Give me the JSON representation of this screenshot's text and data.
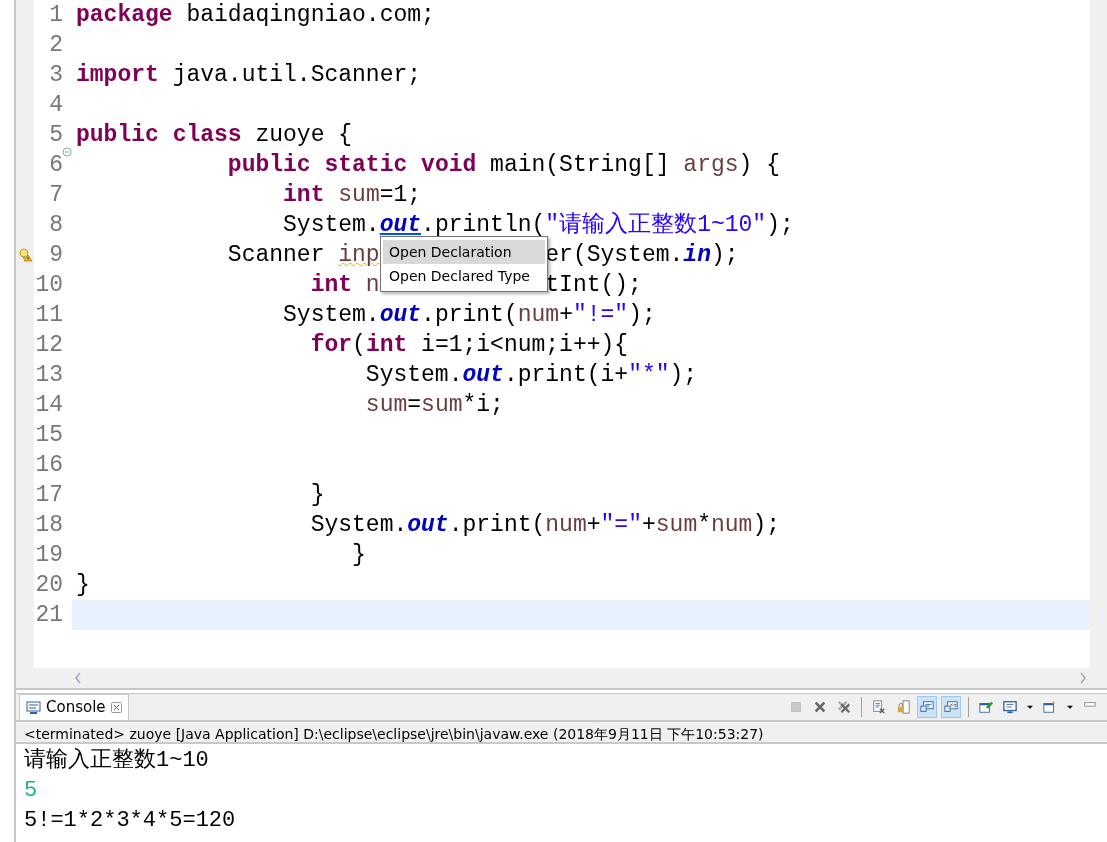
{
  "editor": {
    "lines": [
      {
        "number": "1",
        "kind": "plain",
        "current": false,
        "tokens": [
          {
            "kind": "keyword",
            "text": "package"
          },
          {
            "kind": "plain",
            "text": " baidaqingniao.com;"
          }
        ]
      },
      {
        "number": "2",
        "kind": "plain",
        "current": false
      },
      {
        "number": "3",
        "kind": "plain",
        "current": false,
        "tokens": [
          {
            "kind": "keyword",
            "text": "import"
          },
          {
            "kind": "plain",
            "text": " java.util.Scanner;"
          }
        ]
      },
      {
        "number": "4",
        "kind": "plain",
        "current": false
      },
      {
        "number": "5",
        "kind": "plain",
        "current": false,
        "tokens": [
          {
            "kind": "keyword",
            "text": "public"
          },
          {
            "kind": "keyword",
            "text": " class"
          },
          {
            "kind": "plain",
            "text": " zuoye {"
          }
        ]
      },
      {
        "number": "6",
        "kind": "fold",
        "current": false,
        "tokens": [
          {
            "kind": "keyword",
            "text": "           public"
          },
          {
            "kind": "keyword",
            "text": " static"
          },
          {
            "kind": "keyword",
            "text": " void"
          },
          {
            "kind": "plain",
            "text": " main(String[] "
          },
          {
            "kind": "local",
            "text": "args"
          },
          {
            "kind": "plain",
            "text": ") {"
          }
        ]
      },
      {
        "number": "7",
        "kind": "plain",
        "current": false,
        "tokens": [
          {
            "kind": "keyword",
            "text": "               int"
          },
          {
            "kind": "local",
            "text": " sum"
          },
          {
            "kind": "plain",
            "text": "=1;"
          }
        ]
      },
      {
        "number": "8",
        "kind": "plain",
        "current": false,
        "tokens": [
          {
            "kind": "plain",
            "text": "               System."
          },
          {
            "kind": "link",
            "text": "out"
          },
          {
            "kind": "plain",
            "text": ".println("
          },
          {
            "kind": "string",
            "text": "\"请输入正整数1~10\""
          },
          {
            "kind": "plain",
            "text": ");"
          }
        ]
      },
      {
        "number": "9",
        "kind": "warning",
        "current": false,
        "tokens": [
          {
            "kind": "plain",
            "text": "           Scanner "
          },
          {
            "kind": "local-warning",
            "text": "inp"
          },
          {
            "kind": "covered"
          },
          {
            "kind": "plain",
            "text": "er(System."
          },
          {
            "kind": "field",
            "text": "in"
          },
          {
            "kind": "plain",
            "text": ");"
          }
        ]
      },
      {
        "number": "10",
        "kind": "plain",
        "current": false,
        "tokens": [
          {
            "kind": "keyword",
            "text": "                 int"
          },
          {
            "kind": "local",
            "text": " n"
          },
          {
            "kind": "covered"
          },
          {
            "kind": "plain",
            "text": "tInt();"
          }
        ]
      },
      {
        "number": "11",
        "kind": "plain",
        "current": false,
        "tokens": [
          {
            "kind": "plain",
            "text": "               System."
          },
          {
            "kind": "field",
            "text": "out"
          },
          {
            "kind": "plain",
            "text": ".print("
          },
          {
            "kind": "local",
            "text": "num"
          },
          {
            "kind": "plain",
            "text": "+"
          },
          {
            "kind": "string",
            "text": "\"!=\""
          },
          {
            "kind": "plain",
            "text": ");"
          }
        ]
      },
      {
        "number": "12",
        "kind": "plain",
        "current": false,
        "tokens": [
          {
            "kind": "keyword",
            "text": "                 for"
          },
          {
            "kind": "plain",
            "text": "("
          },
          {
            "kind": "keyword",
            "text": "int"
          },
          {
            "kind": "plain",
            "text": " i=1;i<num;i++){"
          }
        ]
      },
      {
        "number": "13",
        "kind": "plain",
        "current": false,
        "tokens": [
          {
            "kind": "plain",
            "text": "                     System."
          },
          {
            "kind": "field",
            "text": "out"
          },
          {
            "kind": "plain",
            "text": ".print(i+"
          },
          {
            "kind": "string",
            "text": "\"*\""
          },
          {
            "kind": "plain",
            "text": ");"
          }
        ]
      },
      {
        "number": "14",
        "kind": "plain",
        "current": false,
        "tokens": [
          {
            "kind": "local",
            "text": "                     sum"
          },
          {
            "kind": "plain",
            "text": "="
          },
          {
            "kind": "local",
            "text": "sum"
          },
          {
            "kind": "plain",
            "text": "*i;"
          }
        ]
      },
      {
        "number": "15",
        "kind": "plain",
        "current": false
      },
      {
        "number": "16",
        "kind": "plain",
        "current": false
      },
      {
        "number": "17",
        "kind": "plain",
        "current": false,
        "tokens": [
          {
            "kind": "plain",
            "text": "                 }"
          }
        ]
      },
      {
        "number": "18",
        "kind": "plain",
        "current": false,
        "tokens": [
          {
            "kind": "plain",
            "text": "                 System."
          },
          {
            "kind": "field",
            "text": "out"
          },
          {
            "kind": "plain",
            "text": ".print("
          },
          {
            "kind": "local",
            "text": "num"
          },
          {
            "kind": "plain",
            "text": "+"
          },
          {
            "kind": "string",
            "text": "\"=\""
          },
          {
            "kind": "plain",
            "text": "+"
          },
          {
            "kind": "local",
            "text": "sum"
          },
          {
            "kind": "plain",
            "text": "*"
          },
          {
            "kind": "local",
            "text": "num"
          },
          {
            "kind": "plain",
            "text": ");"
          }
        ]
      },
      {
        "number": "19",
        "kind": "plain",
        "current": false,
        "tokens": [
          {
            "kind": "plain",
            "text": "                    }"
          }
        ]
      },
      {
        "number": "20",
        "kind": "plain",
        "current": false,
        "tokens": [
          {
            "kind": "plain",
            "text": "}"
          }
        ]
      },
      {
        "number": "21",
        "kind": "plain",
        "current": true
      }
    ]
  },
  "popup_menu": {
    "items": [
      {
        "label": "Open Declaration",
        "selected": true
      },
      {
        "label": "Open Declared Type",
        "selected": false
      }
    ]
  },
  "console": {
    "tab": {
      "title": "Console"
    },
    "toolbar": [
      {
        "kind": "terminate",
        "disabled": true,
        "pressed": false
      },
      {
        "kind": "remove-launch",
        "disabled": false,
        "pressed": false
      },
      {
        "kind": "remove-all",
        "disabled": false,
        "pressed": false
      },
      {
        "kind": "separator"
      },
      {
        "kind": "clear",
        "disabled": false,
        "pressed": false
      },
      {
        "kind": "scroll-lock",
        "disabled": false,
        "pressed": false
      },
      {
        "kind": "show-stdout",
        "disabled": false,
        "pressed": true
      },
      {
        "kind": "show-stderr",
        "disabled": false,
        "pressed": true
      },
      {
        "kind": "separator"
      },
      {
        "kind": "pin",
        "disabled": false,
        "pressed": false
      },
      {
        "kind": "display-console",
        "disabled": false,
        "pressed": false
      },
      {
        "kind": "dropdown",
        "disabled": false,
        "pressed": false
      },
      {
        "kind": "open-console",
        "disabled": false,
        "pressed": false
      },
      {
        "kind": "dropdown",
        "disabled": false,
        "pressed": false
      },
      {
        "kind": "minimize",
        "disabled": false,
        "pressed": false
      }
    ],
    "info": "<terminated> zuoye [Java Application] D:\\eclipse\\eclipse\\jre\\bin\\javaw.exe (2018年9月11日 下午10:53:27)",
    "output": [
      {
        "kind": "stdout",
        "text": "请输入正整数1~10"
      },
      {
        "kind": "stdin",
        "text": "5"
      },
      {
        "kind": "stdout",
        "text": "5!=1*2*3*4*5=120"
      }
    ]
  }
}
